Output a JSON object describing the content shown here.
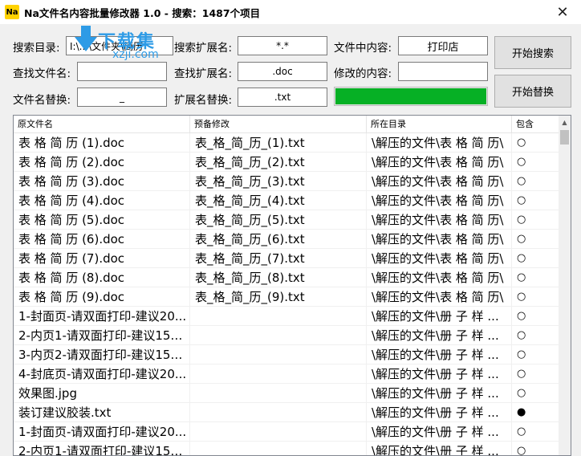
{
  "window": {
    "icon_text": "Na",
    "title": "Na文件名内容批量修改器 1.0  -  搜索：1487个项目",
    "close_glyph": "✕"
  },
  "form": {
    "search_dir_label": "搜索目录:",
    "search_dir_value": "I:\\...\\文件夹\\简历",
    "search_ext_label": "搜索扩展名:",
    "search_ext_value": "*.*",
    "content_label": "文件中内容:",
    "content_value": "打印店",
    "find_name_label": "查找文件名:",
    "find_name_value": "",
    "find_ext_label": "查找扩展名:",
    "find_ext_value": ".doc",
    "modify_content_label": "修改的内容:",
    "modify_content_value": "",
    "rename_label": "文件名替换:",
    "rename_value": "_",
    "ext_replace_label": "扩展名替换:",
    "ext_replace_value": ".txt",
    "progress": 1.0,
    "progress_color": "#06b025"
  },
  "buttons": {
    "search": "开始搜索",
    "replace": "开始替换"
  },
  "watermark": {
    "text": "下载集",
    "sub": "xzji.com"
  },
  "table": {
    "headers": [
      "原文件名",
      "预备修改",
      "所在目录",
      "包含"
    ],
    "rows": [
      [
        "表 格 简 历 (1).doc",
        "表_格_简_历_(1).txt",
        "\\解压的文件\\表 格 简 历\\",
        "○"
      ],
      [
        "表 格 简 历 (2).doc",
        "表_格_简_历_(2).txt",
        "\\解压的文件\\表 格 简 历\\",
        "○"
      ],
      [
        "表 格 简 历 (3).doc",
        "表_格_简_历_(3).txt",
        "\\解压的文件\\表 格 简 历\\",
        "○"
      ],
      [
        "表 格 简 历 (4).doc",
        "表_格_简_历_(4).txt",
        "\\解压的文件\\表 格 简 历\\",
        "○"
      ],
      [
        "表 格 简 历 (5).doc",
        "表_格_简_历_(5).txt",
        "\\解压的文件\\表 格 简 历\\",
        "○"
      ],
      [
        "表 格 简 历 (6).doc",
        "表_格_简_历_(6).txt",
        "\\解压的文件\\表 格 简 历\\",
        "○"
      ],
      [
        "表 格 简 历 (7).doc",
        "表_格_简_历_(7).txt",
        "\\解压的文件\\表 格 简 历\\",
        "○"
      ],
      [
        "表 格 简 历 (8).doc",
        "表_格_简_历_(8).txt",
        "\\解压的文件\\表 格 简 历\\",
        "○"
      ],
      [
        "表 格 简 历 (9).doc",
        "表_格_简_历_(9).txt",
        "\\解压的文件\\表 格 简 历\\",
        "○"
      ],
      [
        "1-封面页-请双面打印-建议20...",
        "",
        "\\解压的文件\\册 子 样 ...",
        "○"
      ],
      [
        "2-内页1-请双面打印-建议157...",
        "",
        "\\解压的文件\\册 子 样 ...",
        "○"
      ],
      [
        "3-内页2-请双面打印-建议157...",
        "",
        "\\解压的文件\\册 子 样 ...",
        "○"
      ],
      [
        "4-封底页-请双面打印-建议20...",
        "",
        "\\解压的文件\\册 子 样 ...",
        "○"
      ],
      [
        "效果图.jpg",
        "",
        "\\解压的文件\\册 子 样 ...",
        "○"
      ],
      [
        "装订建议胶装.txt",
        "",
        "\\解压的文件\\册 子 样 ...",
        "●"
      ],
      [
        "1-封面页-请双面打印-建议20...",
        "",
        "\\解压的文件\\册 子 样 ...",
        "○"
      ],
      [
        "2-内页1-请双面打印-建议157...",
        "",
        "\\解压的文件\\册 子 样 ...",
        "○"
      ]
    ]
  }
}
